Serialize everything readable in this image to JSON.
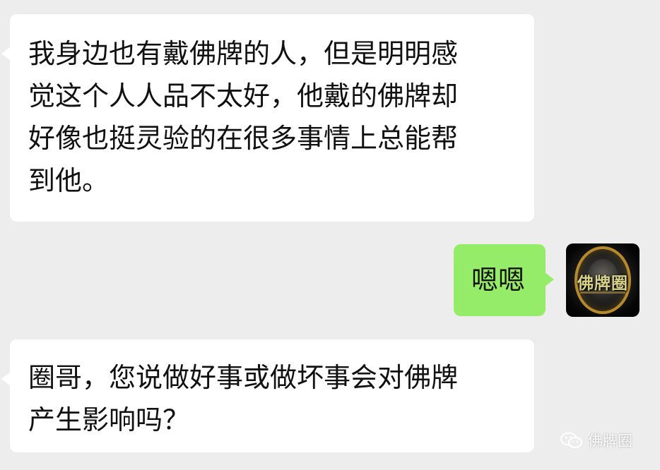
{
  "messages": [
    {
      "direction": "incoming",
      "lines": [
        "我身边也有戴佛牌的人，但是明明感",
        "觉这个人人品不太好，他戴的佛牌却",
        "好像也挺灵验的在很多事情上总能帮",
        "到他。"
      ]
    },
    {
      "direction": "outgoing",
      "lines": [
        "嗯嗯"
      ]
    },
    {
      "direction": "incoming",
      "lines": [
        "圈哥，您说做好事或做坏事会对佛牌",
        "产生影响吗？"
      ]
    }
  ],
  "avatar": {
    "text": "佛牌圈",
    "icon": "amulet-avatar"
  },
  "watermark": {
    "text": "佛牌圈",
    "icon": "wechat-icon"
  },
  "colors": {
    "background": "#ededed",
    "incoming_bubble": "#ffffff",
    "outgoing_bubble": "#95ec69",
    "text": "#111111"
  }
}
